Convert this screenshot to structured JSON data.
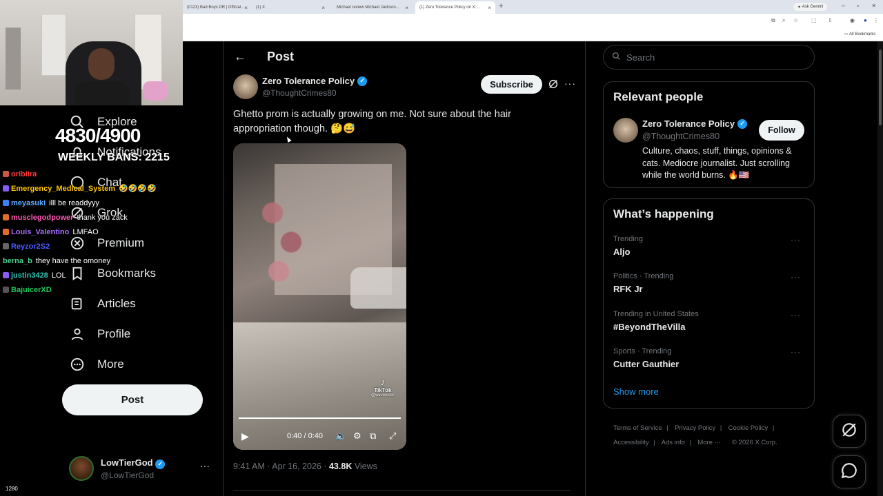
{
  "browser": {
    "tabs": [
      {
        "title": "(0123) Bad Boys DR | Official ...",
        "active": false
      },
      {
        "title": "(1) X",
        "active": false
      },
      {
        "title": "Michael review Michael Jackson...",
        "active": false
      },
      {
        "title": "(1) Zero Tolerance Policy on X:...",
        "active": true
      }
    ],
    "new_tab": "+",
    "ask_gemini": "Ask Gemini",
    "all_bookmarks": "All Bookmarks"
  },
  "stream": {
    "counter": "4830/4900",
    "weekly": "WEEKLY BANS: 2215",
    "viewer_count": "1280",
    "chat": [
      {
        "user": "oribiira",
        "color": "#ff3b3b",
        "text": ""
      },
      {
        "user": "Emergency_Medical_System",
        "color": "#ffc400",
        "text": "🤣🤣🤣🤣"
      },
      {
        "user": "meyasuki",
        "color": "#5da9ff",
        "text": "illl be readdyyy"
      },
      {
        "user": "musclegodpower",
        "color": "#ff5ab4",
        "text": "thank you zack"
      },
      {
        "user": "Louis_Valentino",
        "color": "#a66bff",
        "text": "LMFAO"
      },
      {
        "user": "Reyzor2S2",
        "color": "#4b5cff",
        "text": ""
      },
      {
        "user": "berna_b",
        "color": "#4fd18b",
        "text": "they have the omoney"
      },
      {
        "user": "justin3428",
        "color": "#2ec4b6",
        "text": "LOL"
      },
      {
        "user": "BajuicerXD",
        "color": "#1ec95b",
        "text": ""
      }
    ]
  },
  "nav": {
    "items": [
      {
        "label": "Explore",
        "icon": "search-icon"
      },
      {
        "label": "Notifications",
        "icon": "bell-icon"
      },
      {
        "label": "Chat",
        "icon": "chat-icon"
      },
      {
        "label": "Grok",
        "icon": "grok-icon"
      },
      {
        "label": "Premium",
        "icon": "x-premium-icon"
      },
      {
        "label": "Bookmarks",
        "icon": "bookmark-icon"
      },
      {
        "label": "Articles",
        "icon": "article-icon"
      },
      {
        "label": "Profile",
        "icon": "person-icon"
      },
      {
        "label": "More",
        "icon": "more-circle-icon"
      }
    ],
    "post_button": "Post",
    "account": {
      "name": "LowTierGod",
      "handle": "@LowTierGod"
    }
  },
  "post": {
    "header": "Post",
    "author": {
      "name": "Zero Tolerance Policy",
      "handle": "@ThoughtCrimes80"
    },
    "subscribe": "Subscribe",
    "text": "Ghetto prom is actually growing on me. Not sure about the hair appropriation though. 🤔😅",
    "video": {
      "watermark": "TikTok",
      "watermark_handle": "@weventsllc",
      "time": "0:40 / 0:40",
      "progress": 1.0
    },
    "timestamp": "9:41 AM · Apr 16, 2026 · ",
    "views_count": "43.8K",
    "views_label": " Views"
  },
  "sidebar": {
    "search_placeholder": "Search",
    "relevant_people": {
      "title": "Relevant people",
      "name": "Zero Tolerance Policy",
      "handle": "@ThoughtCrimes80",
      "bio": "Culture, chaos, stuff, things, opinions & cats. Mediocre journalist. Just scrolling while the world burns. 🔥🇺🇸",
      "follow": "Follow"
    },
    "happening": {
      "title": "What’s happening",
      "trends": [
        {
          "context": "Trending",
          "name": "Aljo"
        },
        {
          "context": "Politics · Trending",
          "name": "RFK Jr"
        },
        {
          "context": "Trending in United States",
          "name": "#BeyondTheVilla"
        },
        {
          "context": "Sports · Trending",
          "name": "Cutter Gauthier"
        }
      ],
      "show_more": "Show more"
    },
    "footer": {
      "terms": "Terms of Service",
      "privacy": "Privacy Policy",
      "cookie": "Cookie Policy",
      "accessibility": "Accessibility",
      "ads": "Ads info",
      "more": "More ···",
      "copyright": "© 2026 X Corp."
    }
  },
  "colors": {
    "accent": "#1d9bf0",
    "background": "#000000",
    "text": "#e7e9ea",
    "muted": "#71767b"
  }
}
